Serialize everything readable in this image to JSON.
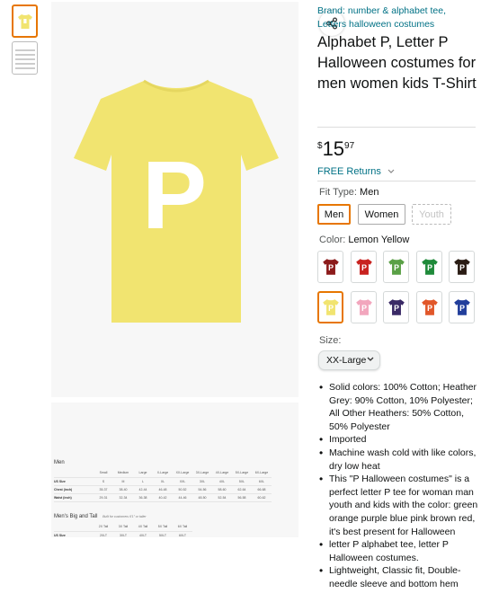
{
  "brand": {
    "text": "Brand: number & alphabet tee, Letters halloween costumes"
  },
  "title": "Alphabet P, Letter P Halloween costumes for men women kids T-Shirt",
  "price": {
    "symbol": "$",
    "whole": "15",
    "fraction": "97"
  },
  "returns": "FREE Returns",
  "fit_type": {
    "label": "Fit Type:",
    "selected": "Men",
    "options": [
      "Men",
      "Women",
      "Youth"
    ]
  },
  "color": {
    "label": "Color:",
    "selected": "Lemon Yellow",
    "swatches": [
      "#8c1b1b",
      "#c8221f",
      "#5aa046",
      "#1f8a3a",
      "#2a1c14",
      "#f1e470",
      "#f2a6bd",
      "#3a2a66",
      "#e1572a",
      "#223e9b"
    ]
  },
  "size": {
    "label": "Size:",
    "selected": "XX-Large"
  },
  "shirt": {
    "letter": "P",
    "color": "#f1e470"
  },
  "bullets": [
    "Solid colors: 100% Cotton; Heather Grey: 90% Cotton, 10% Polyester; All Other Heathers: 50% Cotton, 50% Polyester",
    "Imported",
    "Machine wash cold with like colors, dry low heat",
    "This \"P Halloween costumes\" is a perfect letter P tee for woman man youth and kids with the color: green orange purple blue pink brown red, it's best present for Halloween",
    "letter P alphabet tee, letter P Halloween costumes.",
    "Lightweight, Classic fit, Double-needle sleeve and bottom hem"
  ],
  "size_chart": {
    "men_title": "Men",
    "headers": [
      "Small",
      "Medium",
      "Large",
      "X-Large",
      "XX-Large",
      "3X-Large",
      "4X-Large",
      "5X-Large",
      "6X-Large"
    ],
    "rows": [
      {
        "name": "US Size",
        "cells": [
          "S",
          "M",
          "L",
          "XL",
          "XXL",
          "3XL",
          "4XL",
          "5XL",
          "6XL"
        ]
      },
      {
        "name": "Chest (inch)",
        "cells": [
          "35-37",
          "38-40",
          "42-44",
          "46-48",
          "50-52",
          "54-56",
          "58-60",
          "62-64",
          "66-68"
        ]
      },
      {
        "name": "Waist (inch)",
        "cells": [
          "29-31",
          "32-34",
          "36-38",
          "40-42",
          "44-46",
          "48-50",
          "52-54",
          "56-58",
          "60-62"
        ]
      }
    ],
    "big_title": "Men's Big and Tall",
    "big_note": "Built for customers 6'1\" or taller",
    "big_headers": [
      "2X Tall",
      "3X Tall",
      "4X Tall",
      "5X Tall",
      "6X Tall"
    ],
    "big_row": {
      "name": "US Size",
      "cells": [
        "2XLT",
        "3XLT",
        "4XLT",
        "5XLT",
        "6XLT"
      ]
    }
  }
}
